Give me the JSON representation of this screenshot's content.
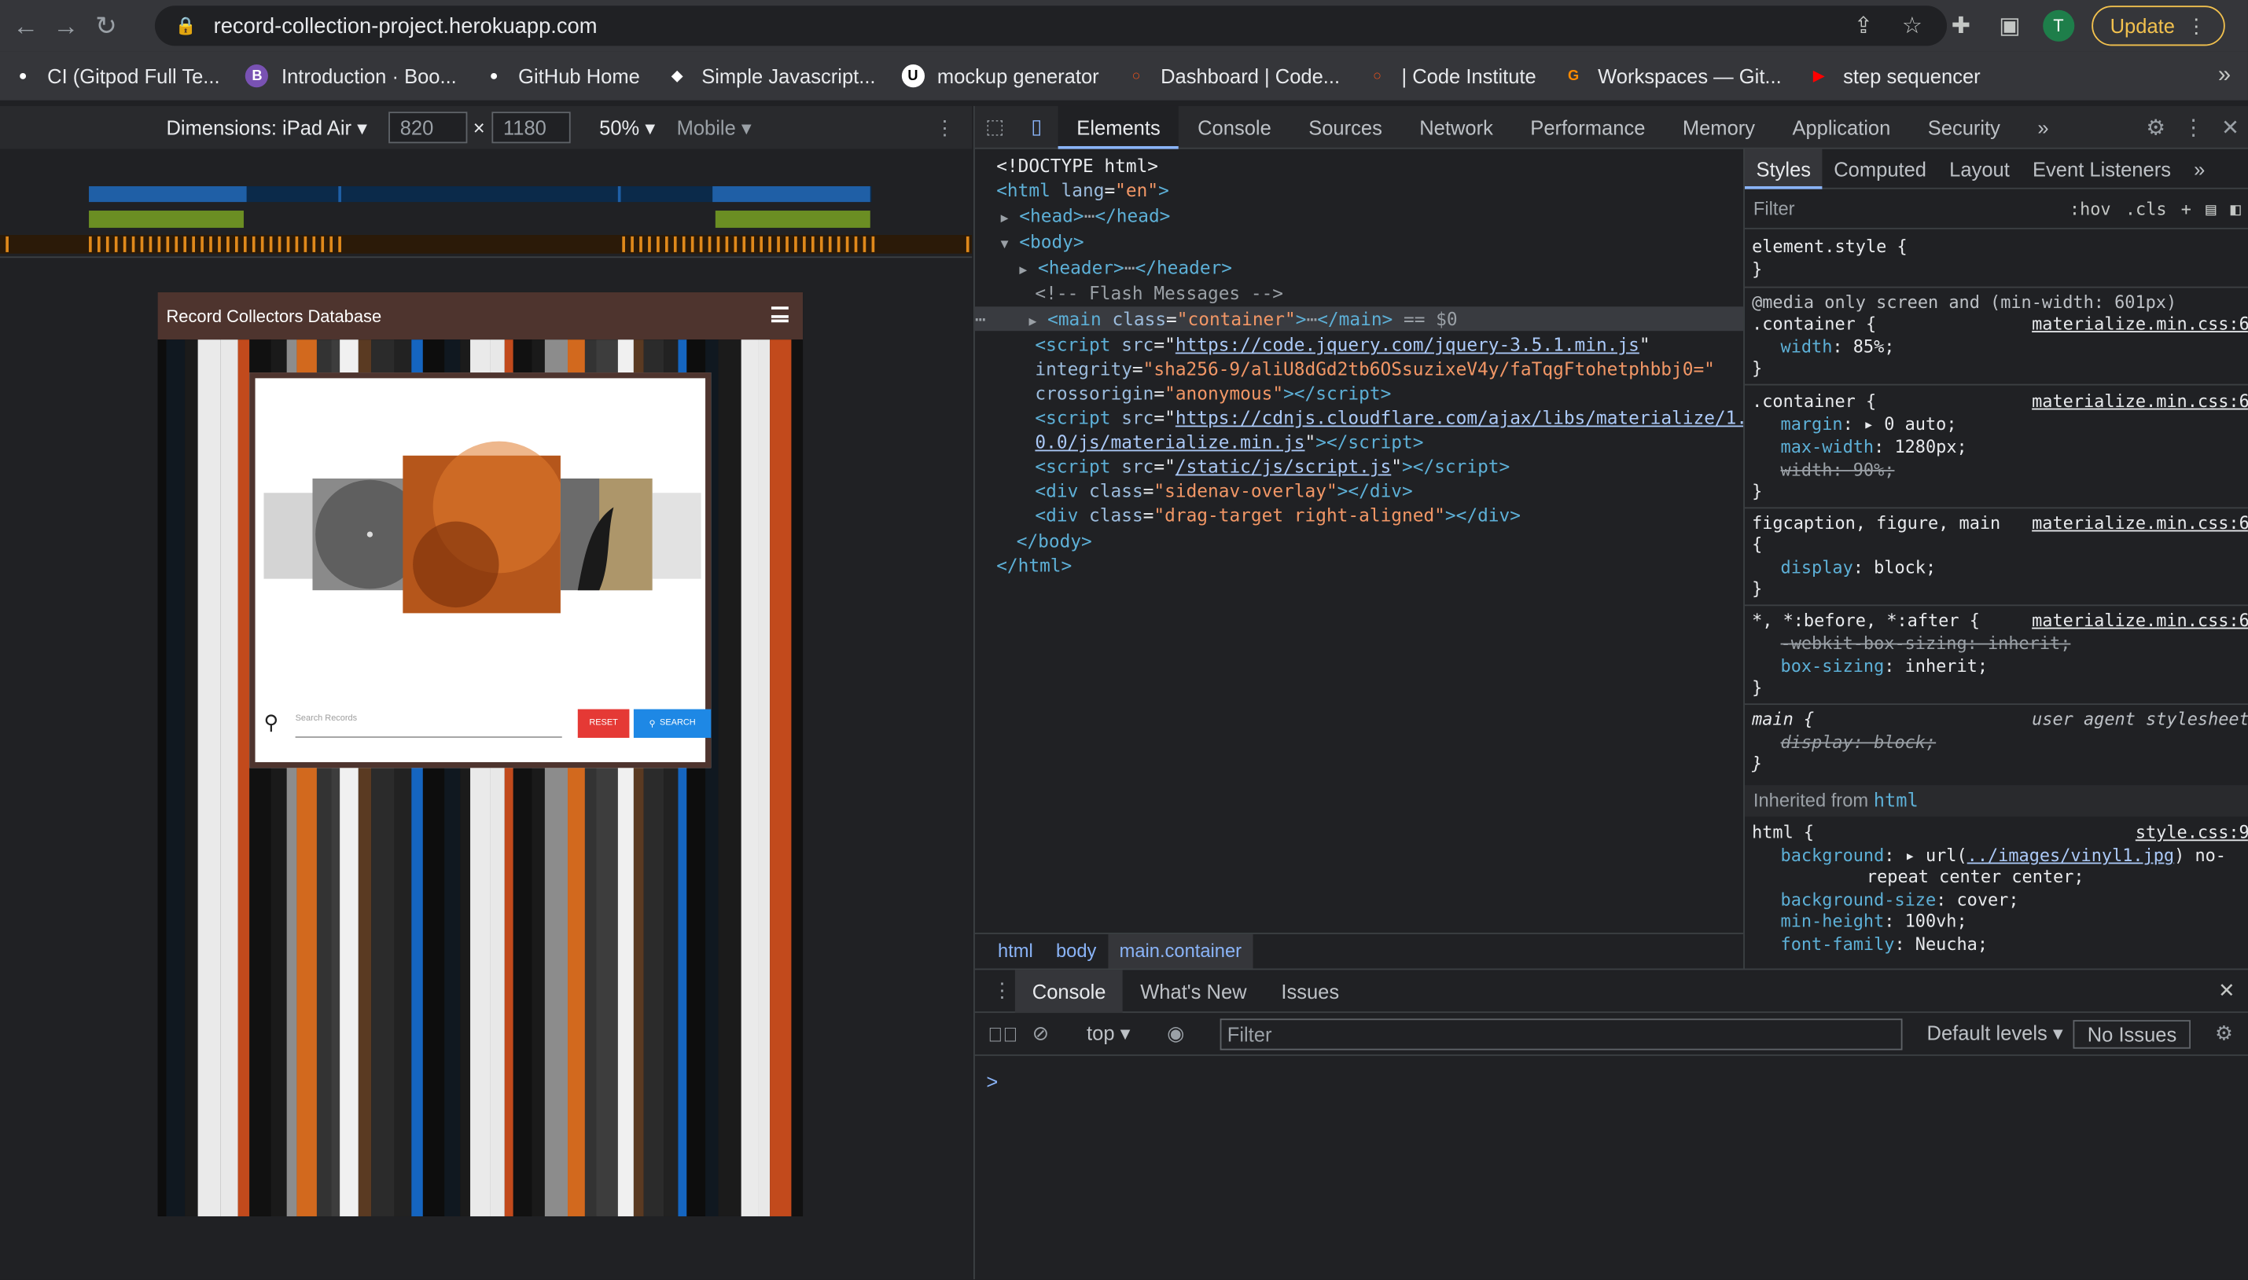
{
  "browser": {
    "url": "record-collection-project.herokuapp.com",
    "avatar_letter": "T",
    "update_label": "Update"
  },
  "bookmarks": [
    {
      "label": "CI (Gitpod Full Te...",
      "icon": "github-icon",
      "color": "#ffffff"
    },
    {
      "label": "Introduction · Boo...",
      "icon": "bootstrap-icon",
      "color": "#7952b3"
    },
    {
      "label": "GitHub Home",
      "icon": "github-icon",
      "color": "#ffffff"
    },
    {
      "label": "Simple Javascript...",
      "icon": "codepen-icon",
      "color": "#ffffff"
    },
    {
      "label": "mockup generator",
      "icon": "mockup-icon",
      "color": "#000000"
    },
    {
      "label": "Dashboard | Code...",
      "icon": "code-institute-icon",
      "color": "#e0501e"
    },
    {
      "label": "| Code Institute",
      "icon": "code-institute-icon",
      "color": "#e0501e"
    },
    {
      "label": "Workspaces — Git...",
      "icon": "gitpod-icon",
      "color": "#ff8a00"
    },
    {
      "label": "step sequencer",
      "icon": "youtube-icon",
      "color": "#ff0000"
    }
  ],
  "device_toolbar": {
    "dimensions_label": "Dimensions: iPad Air",
    "width": "820",
    "times": "×",
    "height": "1180",
    "zoom": "50%",
    "mode": "Mobile"
  },
  "site": {
    "brand": "Record Collectors Database",
    "search_placeholder": "Search Records",
    "reset_label": "RESET",
    "search_label": "SEARCH"
  },
  "devtools": {
    "tabs": [
      "Elements",
      "Console",
      "Sources",
      "Network",
      "Performance",
      "Memory",
      "Application",
      "Security"
    ],
    "active_tab": "Elements",
    "more": "»",
    "dom": {
      "doctype": "<!DOCTYPE html>",
      "html_open": "<html",
      "lang_attr": " lang",
      "lang_val": "\"en\"",
      "head": "<head>",
      "head_close": "</head>",
      "body": "<body>",
      "header": "<header>",
      "header_close": "</header>",
      "comment": "<!-- Flash Messages -->",
      "main_open": "<main",
      "main_class": " class",
      "main_class_val": "\"container\"",
      "main_close": "</main>",
      "main_suffix": " == $0",
      "script1_src": "https://code.jquery.com/jquery-3.5.1.min.js",
      "script1_integrity": "\"sha256-9/aliU8dGd2tb6OSsuzixeV4y/faTqgFtohetphbbj0=\"",
      "script1_crossorigin": "\"anonymous\"",
      "script2_src_a": "https://cdnjs.cloudflare.com/ajax/libs/materialize/1.",
      "script2_src_b": "0.0/js/materialize.min.js",
      "script3_src": "/static/js/script.js",
      "div1_class": "\"sidenav-overlay\"",
      "div2_class": "\"drag-target right-aligned\"",
      "body_close": "</body>",
      "html_close": "</html>"
    },
    "breadcrumbs": [
      "html",
      "body",
      "main.container"
    ],
    "styles_tabs": [
      "Styles",
      "Computed",
      "Layout",
      "Event Listeners"
    ],
    "styles_more": "»",
    "styles_filter": "Filter",
    "hov": ":hov",
    "cls": ".cls",
    "rules": {
      "element_style": "element.style {",
      "close": "}",
      "media": "@media only screen and (min-width: 601px)",
      "container_sel": ".container {",
      "width_prop": "width",
      "width_val": ": 85%;",
      "margin_prop": "margin",
      "margin_val": ": ▸ 0 auto;",
      "maxw_prop": "max-width",
      "maxw_val": ": 1280px;",
      "width90": "width: 90%;",
      "figcaption_sel": "figcaption, figure, main",
      "open_brace": "{",
      "display_prop": "display",
      "display_val": ": block;",
      "universal_sel": "*, *:before, *:after {",
      "webkit_box": "-webkit-box-sizing: inherit;",
      "box_prop": "box-sizing",
      "box_val": ": inherit;",
      "main_sel": "main {",
      "ua_label": "user agent stylesheet",
      "display_block_strike": "display: block;",
      "inherited_from": "Inherited from",
      "inherited_tag": "html",
      "html_sel": "html {",
      "bg_prop": "background",
      "bg_val_a": ": ▸ url(",
      "bg_link": "../images/vinyl1.jpg",
      "bg_val_b": ") no-",
      "bg_val_c": "repeat center center;",
      "bgsize_prop": "background-size",
      "bgsize_val": ": cover;",
      "minh_prop": "min-height",
      "minh_val": ": 100vh;",
      "font_prop": "font-family",
      "font_val": ": Neucha;",
      "materialize_src": "materialize.min.css:6",
      "style_src": "style.css:9"
    },
    "drawer_tabs": [
      "Console",
      "What's New",
      "Issues"
    ],
    "drawer_active": "Console",
    "context": "top",
    "filter_placeholder": "Filter",
    "levels": "Default levels",
    "issues": "No Issues",
    "prompt": ">"
  }
}
